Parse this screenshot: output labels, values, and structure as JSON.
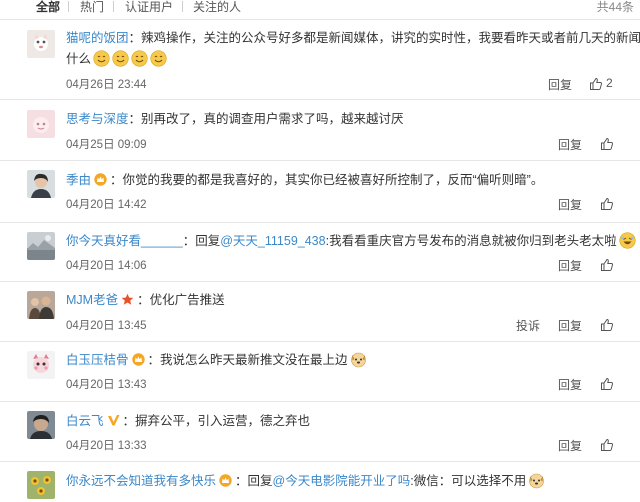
{
  "filter_tabs": [
    "全部",
    "热门",
    "认证用户",
    "关注的人"
  ],
  "total_count": "共44条",
  "actions": {
    "reply": "回复",
    "report": "投诉"
  },
  "colors": {
    "username": "#3b88c9",
    "text": "#333333",
    "meta": "#666666",
    "badge": "#f5a623"
  },
  "comments": [
    {
      "username": "猫呢的饭团",
      "text_line1": "：辣鸡操作，关注的公众号好多都是新闻媒体，讲究的实时性，我要看昨天或者前几天的新闻做",
      "text_line2": "什么",
      "emoji_count": 4,
      "emoji": "smile-emoji",
      "time": "04月26日 23:44",
      "likes": "2",
      "avatar": "cat-avatar"
    },
    {
      "username": "思考与深度",
      "text": "：别再改了，真的调查用户需求了吗，越来越讨厌",
      "time": "04月25日 09:09",
      "avatar": "pink-avatar"
    },
    {
      "username": "季由",
      "badge": "crown-badge",
      "text": "：你觉的我要的都是我喜好的，其实你已经被喜好所控制了，反而“偏听则暗”。",
      "time": "04月20日 14:42",
      "avatar": "portrait-avatar"
    },
    {
      "username": "你今天真好看______",
      "text_prefix": "：回复",
      "mention": "@天天_11159_438",
      "text": ":我看看重庆官方号发布的消息就被你归到老头老太啦",
      "emoji": "laugh-emoji",
      "time": "04月20日 14:06",
      "avatar": "landscape-avatar"
    },
    {
      "username": "MJM老爸",
      "badge": "star-badge",
      "text": "：优化广告推送",
      "time": "04月20日 13:45",
      "report": true,
      "avatar": "group-avatar"
    },
    {
      "username": "白玉压桔骨",
      "badge": "crown-badge",
      "text": "：我说怎么昨天最新推文没在最上边",
      "emoji": "dog-emoji",
      "time": "04月20日 13:43",
      "avatar": "cartoon-avatar"
    },
    {
      "username": "白云飞",
      "badge": "v-badge",
      "text": "：摒弃公平，引入运营，德之弃也",
      "time": "04月20日 13:33",
      "avatar": "face-avatar"
    },
    {
      "username": "你永远不会知道我有多快乐",
      "badge": "crown-badge",
      "text_prefix": "：回复",
      "mention": "@今天电影院能开业了吗",
      "text": ":微信：可以选择不用",
      "emoji": "dog-emoji",
      "avatar": "flower-avatar"
    }
  ]
}
